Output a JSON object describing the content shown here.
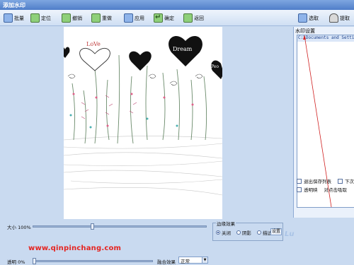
{
  "window": {
    "title": "添加水印"
  },
  "toolbar": {
    "items": [
      {
        "label": "批量",
        "icon": "batch-icon"
      },
      {
        "label": "定位",
        "icon": "locate-icon"
      },
      {
        "label": "撤销",
        "icon": "undo-icon"
      },
      {
        "label": "重做",
        "icon": "redo-icon"
      },
      {
        "label": "应用",
        "icon": "apply-icon"
      },
      {
        "label": "确定",
        "icon": "ok-icon"
      },
      {
        "label": "返回",
        "icon": "back-icon"
      }
    ],
    "right_items": [
      {
        "label": "选取",
        "icon": "select-icon"
      },
      {
        "label": "提取",
        "icon": "user-icon"
      }
    ]
  },
  "canvas": {
    "doodles": [
      "LoVe",
      "Dream",
      "Peo"
    ]
  },
  "right_panel": {
    "title": "水印设置",
    "path": "C:\\Documents and Settings",
    "options": [
      {
        "label": "退出保存列表",
        "checked": false
      },
      {
        "label": "下次",
        "checked": false
      },
      {
        "label": "透明映",
        "checked": false
      },
      {
        "label": "对点击吸取",
        "checked": false
      }
    ]
  },
  "bottom": {
    "size_label": "大小 100%",
    "opacity_label": "透明 0%",
    "blend_label": "融合效果",
    "blend_value": "正常",
    "effects_title": "边缘效果",
    "effects": [
      {
        "label": "关闭",
        "selected": true
      },
      {
        "label": "阴影",
        "selected": false
      },
      {
        "label": "描边",
        "selected": false
      }
    ],
    "watermark_url": "www.qinpinchang.com",
    "effects_button": "设置"
  },
  "colors": {
    "accent": "#4f7ec9",
    "watermark": "#e52420",
    "panel": "#c9daf0"
  }
}
